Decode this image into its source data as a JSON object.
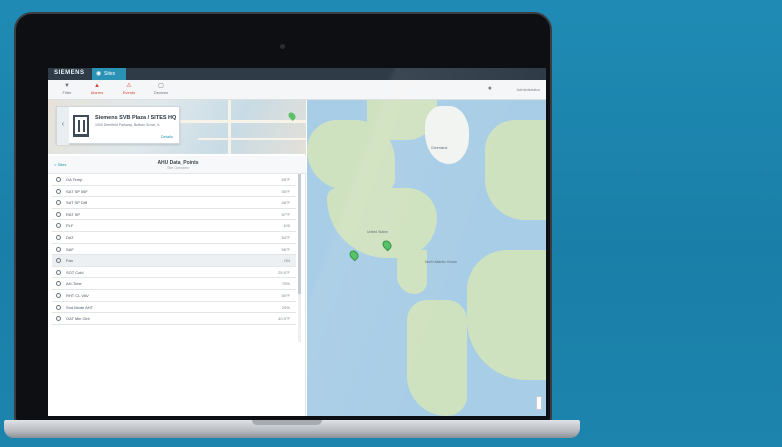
{
  "app": {
    "brand": "SIEMENS",
    "tab_label": "Sites"
  },
  "toolbar": {
    "items": [
      {
        "icon": "filter-icon",
        "label": "Filter"
      },
      {
        "icon": "alarm-icon",
        "label": "Alarms"
      },
      {
        "icon": "alert-icon",
        "label": "Events"
      },
      {
        "icon": "device-icon",
        "label": "Devices"
      }
    ],
    "user": "Administrator"
  },
  "site_card": {
    "title": "Siemens SVB Plaza / SITES HQ",
    "subtitle": "1000 Deerfield Parkway, Buffalo Grove, IL",
    "link": "Details"
  },
  "list": {
    "back_label": "< Sites",
    "title": "AHU Data_Points",
    "subtitle": "Site Overview",
    "rows": [
      {
        "label": "OA Temp",
        "value": "65°F"
      },
      {
        "label": "SAT SP 55F",
        "value": "55°F"
      },
      {
        "label": "SAT SP Diff",
        "value": "46°F"
      },
      {
        "label": "RAT SP",
        "value": "67°F"
      },
      {
        "label": "PLF",
        "value": "100"
      },
      {
        "label": "DAT",
        "value": "54°F"
      },
      {
        "label": "SAF",
        "value": "56°F"
      },
      {
        "label": "Fan",
        "value": "ON"
      },
      {
        "label": "SOT Cold",
        "value": "25.0°F"
      },
      {
        "label": "AH-Time",
        "value": "75%"
      },
      {
        "label": "RHT CL VAV",
        "value": "50°F"
      },
      {
        "label": "Snd Mode AHT",
        "value": "25%"
      },
      {
        "label": "OAT Min Clnt",
        "value": "40.0°F"
      }
    ]
  },
  "map": {
    "labels": [
      "Greenland",
      "North Atlantic Ocean",
      "United States"
    ]
  }
}
